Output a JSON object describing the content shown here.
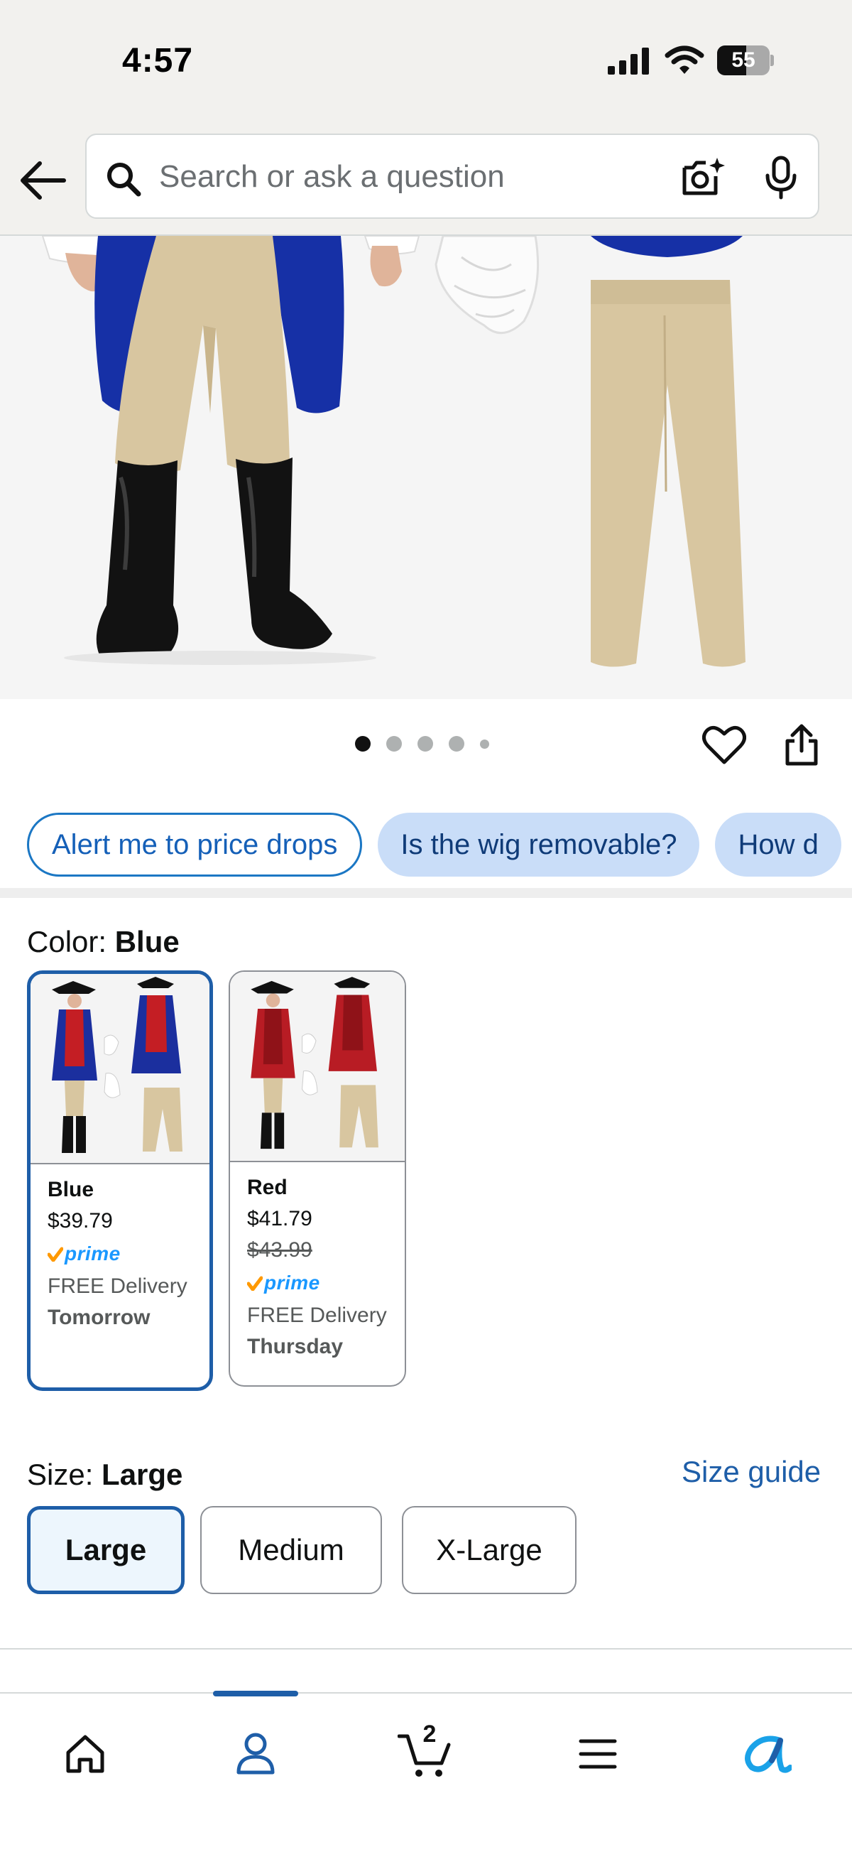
{
  "status_bar": {
    "time": "4:57",
    "battery_level": "55",
    "battery_fraction": 0.55,
    "icons": [
      "cellular-signal-icon",
      "wifi-icon",
      "battery-icon"
    ]
  },
  "header": {
    "search_placeholder": "Search or ask a question",
    "icons": [
      "back-arrow-icon",
      "search-icon",
      "camera-icon",
      "microphone-icon"
    ]
  },
  "product_image": {
    "alt": "Colonial costume: coat, breeches, boots, jabot and pants",
    "carousel_dots": 5,
    "active_index": 0
  },
  "chips": [
    {
      "label": "Alert me to price drops"
    },
    {
      "label": "Is the wig removable?"
    },
    {
      "label": "How d"
    }
  ],
  "color": {
    "prefix": "Color: ",
    "selected": "Blue",
    "options": [
      {
        "name": "Blue",
        "price": "$39.79",
        "old_price": "",
        "prime": "prime",
        "delivery": "FREE Delivery",
        "day": "Tomorrow",
        "coat_color": "#1b2f9e",
        "trim_color": "#c41e24"
      },
      {
        "name": "Red",
        "price": "$41.79",
        "old_price": "$43.99",
        "prime": "prime",
        "delivery": "FREE Delivery",
        "day": "Thursday",
        "coat_color": "#b81c24",
        "trim_color": "#f4f4f4"
      }
    ]
  },
  "size": {
    "prefix": "Size: ",
    "selected": "Large",
    "guide": "Size guide",
    "options": [
      "Large",
      "Medium",
      "X-Large"
    ]
  },
  "tab_bar": {
    "tabs": [
      "home",
      "account",
      "cart",
      "menu",
      "rufus"
    ],
    "active": "account",
    "cart_count": "2"
  },
  "colors": {
    "accent": "#1e5ea8",
    "chip_bg": "#c9ddf8",
    "prime": "#1a98ff",
    "prime_check": "#ff9900",
    "pants": "#d8c6a0",
    "coat_blue": "#1630a6"
  }
}
